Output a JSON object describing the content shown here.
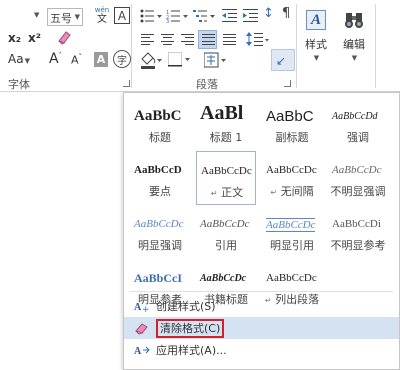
{
  "ribbon": {
    "font_group": {
      "font_size": "五号",
      "phonetic_top": "wén",
      "phonetic_bottom": "文",
      "char_border": "A",
      "subscript": "x₂",
      "superscript": "x²",
      "change_case": "Aa",
      "grow": "A",
      "shrink": "A",
      "shading": "A",
      "enclose": "字",
      "label": "字体"
    },
    "paragraph_group": {
      "sort_icon": "↕",
      "show_marks_icon": "¶",
      "label": "段落"
    },
    "styles_button": {
      "icon": "A",
      "label": "样式"
    },
    "editing_button": {
      "icon": "🔭",
      "label": "编辑"
    }
  },
  "styles_gallery": {
    "tiles": [
      {
        "preview": "AaBbC",
        "name": "标题"
      },
      {
        "preview": "AaBl",
        "name": "标题 1"
      },
      {
        "preview": "AaBbC",
        "name": "副标题"
      },
      {
        "preview": "AaBbCcDd",
        "name": "强调"
      },
      {
        "preview": "AaBbCcD",
        "name": "要点"
      },
      {
        "preview": "AaBbCcDc",
        "name": "正文",
        "mark": "↵"
      },
      {
        "preview": "AaBbCcDc",
        "name": "无间隔",
        "mark": "↵"
      },
      {
        "preview": "AaBbCcDc",
        "name": "不明显强调"
      },
      {
        "preview": "AaBbCcDc",
        "name": "明显强调"
      },
      {
        "preview": "AaBbCcDc",
        "name": "引用"
      },
      {
        "preview": "AaBbCcDc",
        "name": "明显引用"
      },
      {
        "preview": "AaBbCcDi",
        "name": "不明显参考"
      },
      {
        "preview": "AaBbCcI",
        "name": "明显参考"
      },
      {
        "preview": "AaBbCcDc",
        "name": "书籍标题"
      },
      {
        "preview": "AaBbCcDc",
        "name": "列出段落",
        "mark": "↵"
      }
    ],
    "selected": "正文",
    "menu": [
      {
        "label": "创建样式(S)",
        "icon": "create-style-icon"
      },
      {
        "label": "清除格式(C)",
        "icon": "eraser-icon",
        "highlighted": true,
        "boxed": true
      },
      {
        "label": "应用样式(A)...",
        "icon": "apply-styles-icon"
      }
    ]
  },
  "colors": {
    "highlight": "#d5e2f2",
    "accent_red": "#d4202a",
    "selected_border": "#9fb6d3"
  }
}
